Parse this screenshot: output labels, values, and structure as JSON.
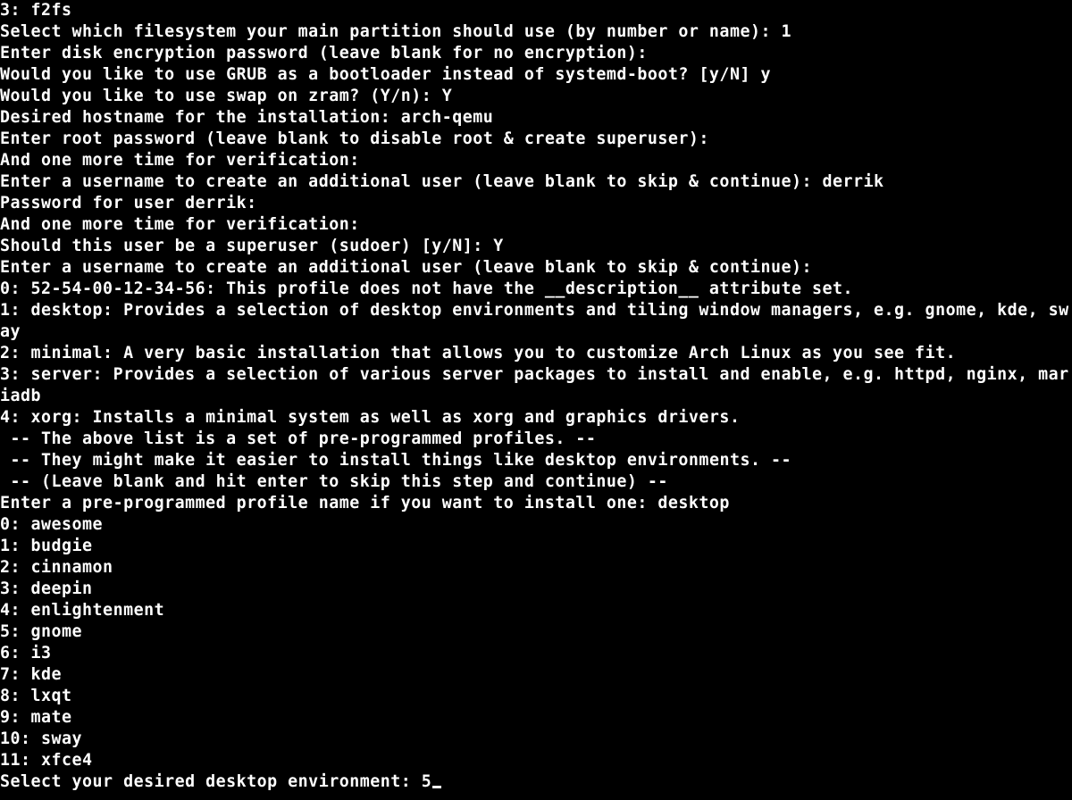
{
  "lines": {
    "l0": "3: f2fs",
    "l1": "Select which filesystem your main partition should use (by number or name): 1",
    "l2": "Enter disk encryption password (leave blank for no encryption):",
    "l3": "Would you like to use GRUB as a bootloader instead of systemd-boot? [y/N] y",
    "l4": "Would you like to use swap on zram? (Y/n): Y",
    "l5": "Desired hostname for the installation: arch-qemu",
    "l6": "Enter root password (leave blank to disable root & create superuser):",
    "l7": "And one more time for verification:",
    "l8": "Enter a username to create an additional user (leave blank to skip & continue): derrik",
    "l9": "Password for user derrik:",
    "l10": "And one more time for verification:",
    "l11": "Should this user be a superuser (sudoer) [y/N]: Y",
    "l12": "Enter a username to create an additional user (leave blank to skip & continue):",
    "l13": "0: 52-54-00-12-34-56: This profile does not have the __description__ attribute set.",
    "l14": "1: desktop: Provides a selection of desktop environments and tiling window managers, e.g. gnome, kde, sway",
    "l15": "2: minimal: A very basic installation that allows you to customize Arch Linux as you see fit.",
    "l16": "3: server: Provides a selection of various server packages to install and enable, e.g. httpd, nginx, mariadb",
    "l17": "4: xorg: Installs a minimal system as well as xorg and graphics drivers.",
    "l18": " -- The above list is a set of pre-programmed profiles. --",
    "l19": " -- They might make it easier to install things like desktop environments. --",
    "l20": " -- (Leave blank and hit enter to skip this step and continue) --",
    "l21": "Enter a pre-programmed profile name if you want to install one: desktop",
    "l22": "0: awesome",
    "l23": "1: budgie",
    "l24": "2: cinnamon",
    "l25": "3: deepin",
    "l26": "4: enlightenment",
    "l27": "5: gnome",
    "l28": "6: i3",
    "l29": "7: kde",
    "l30": "8: lxqt",
    "l31": "9: mate",
    "l32": "10: sway",
    "l33": "11: xfce4",
    "l34": "Select your desired desktop environment: 5"
  }
}
